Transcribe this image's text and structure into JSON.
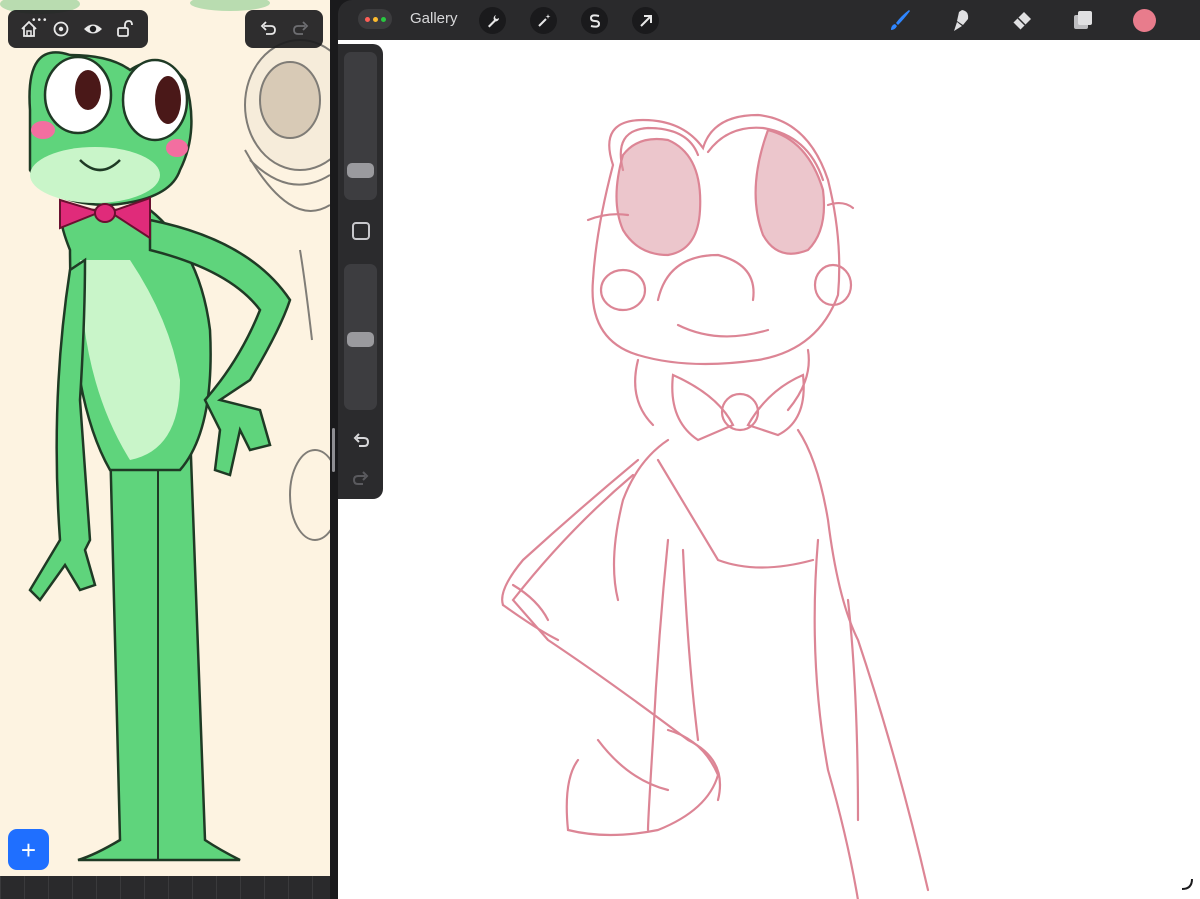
{
  "reference_pane": {
    "toolbar_left": {
      "buttons": [
        "home-icon",
        "settings-icon",
        "eye-icon",
        "unlock-icon"
      ]
    },
    "toolbar_right": {
      "buttons": [
        "undo-icon",
        "redo-icon"
      ]
    },
    "add_button_label": "+",
    "image_description_icon": "frog-character-reference"
  },
  "procreate": {
    "gallery_label": "Gallery",
    "top_tools": [
      "wrench-icon",
      "magic-wand-icon",
      "selection-s-icon",
      "transform-arrow-icon"
    ],
    "right_tools": [
      "brush-icon",
      "smudge-icon",
      "eraser-icon",
      "layers-icon"
    ],
    "colors": {
      "accent_brush": "#2f86ff",
      "current_color": "#e87c8c",
      "sketch_stroke": "#d9788a",
      "window_dot_red": "#ff5f57",
      "window_dot_yellow": "#febc2e",
      "window_dot_green": "#28c840"
    },
    "sidebar": {
      "brush_size_level": 0.15,
      "opacity_level": 0.48
    }
  }
}
